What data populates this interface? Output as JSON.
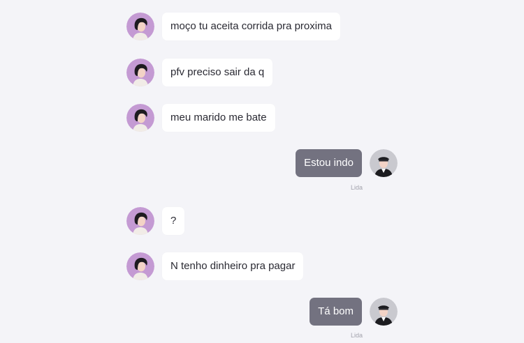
{
  "messages": [
    {
      "direction": "incoming",
      "text": "moço tu aceita corrida pra proxima"
    },
    {
      "direction": "incoming",
      "text": "pfv preciso sair da q"
    },
    {
      "direction": "incoming",
      "text": "meu marido me bate"
    },
    {
      "direction": "outgoing",
      "text": "Estou indo",
      "status": "Lida"
    },
    {
      "direction": "incoming",
      "text": "?"
    },
    {
      "direction": "incoming",
      "text": "N tenho dinheiro pra pagar"
    },
    {
      "direction": "outgoing",
      "text": "Tá bom",
      "status": "Lida"
    }
  ],
  "icons": {
    "passenger_avatar": "woman-avatar-icon",
    "driver_avatar": "driver-avatar-icon"
  },
  "colors": {
    "background": "#f4f4f8",
    "incoming_bubble": "#ffffff",
    "outgoing_bubble": "#737280",
    "passenger_avatar_bg": "#c49ad3",
    "driver_avatar_bg": "#c9c9cf",
    "status_text": "#a3a3ad"
  }
}
